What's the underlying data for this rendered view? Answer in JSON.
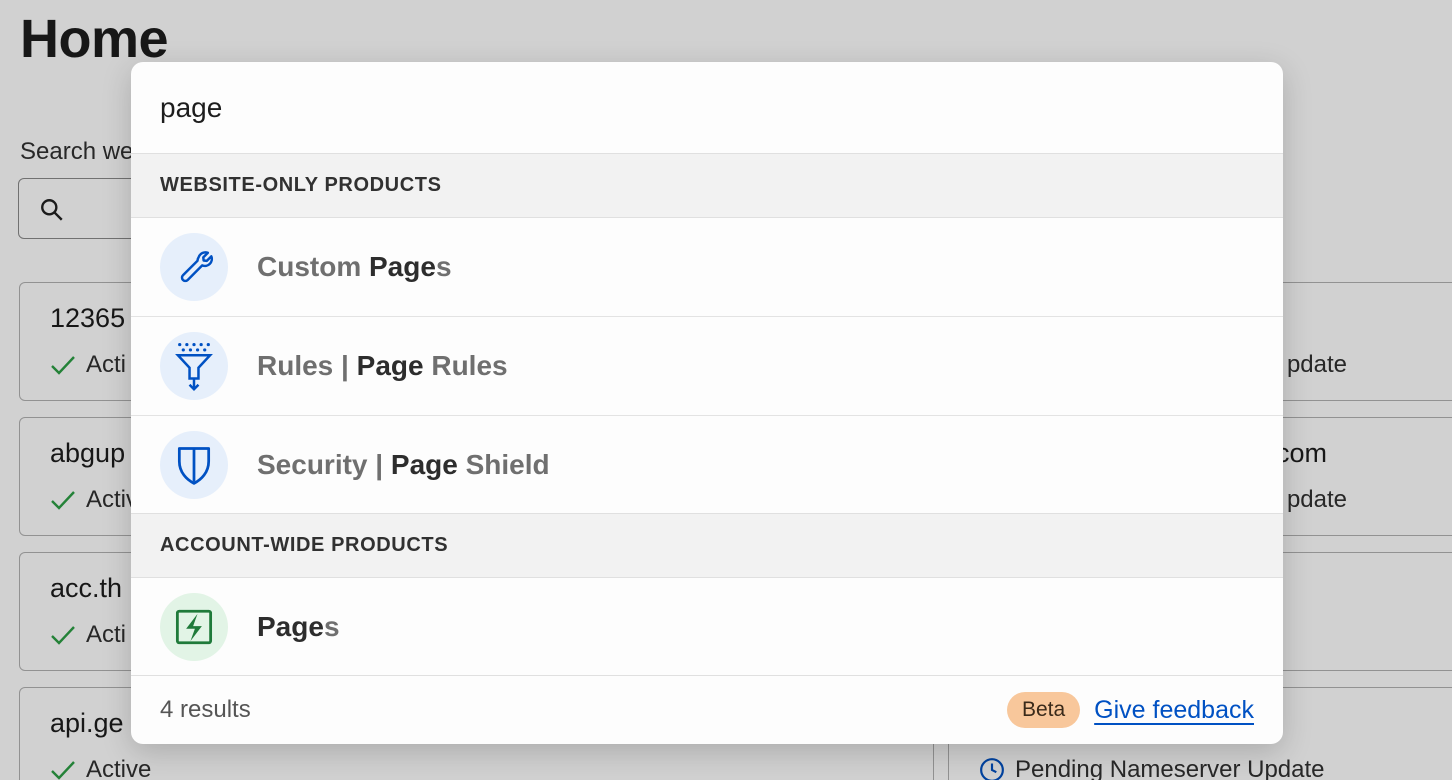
{
  "background": {
    "page_title": "Home",
    "search_label": "Search we",
    "cards": [
      {
        "title": "12365",
        "status": "Acti"
      },
      {
        "title": "abgup",
        "status": "Activ"
      },
      {
        "title": "acc.th",
        "status": "Acti"
      },
      {
        "title": "api.ge",
        "status": "Active"
      }
    ],
    "right_cards": [
      {
        "title": "",
        "status": "pdate"
      },
      {
        "title": "com",
        "status": "pdate"
      },
      {
        "title": "",
        "status": ""
      },
      {
        "title": "",
        "status": "Pending Nameserver Update"
      }
    ]
  },
  "search": {
    "query": "page"
  },
  "sections": [
    {
      "header": "WEBSITE-ONLY PRODUCTS",
      "items": [
        {
          "pre": "Custom ",
          "match": "Page",
          "post": "s",
          "icon": "wrench-icon"
        },
        {
          "pre": "Rules | ",
          "match": "Page",
          "post": " Rules",
          "icon": "funnel-icon"
        },
        {
          "pre": "Security | ",
          "match": "Page",
          "post": " Shield",
          "icon": "shield-icon"
        }
      ]
    },
    {
      "header": "ACCOUNT-WIDE PRODUCTS",
      "items": [
        {
          "pre": "",
          "match": "Page",
          "post": "s",
          "icon": "pages-bolt-icon"
        }
      ]
    }
  ],
  "footer": {
    "count": "4 results",
    "badge": "Beta",
    "feedback": "Give feedback"
  },
  "colors": {
    "accent_blue": "#0051c3",
    "success_green": "#2c9f45",
    "pages_green": "#1f7a3a",
    "beta_orange": "#f8c79b"
  }
}
